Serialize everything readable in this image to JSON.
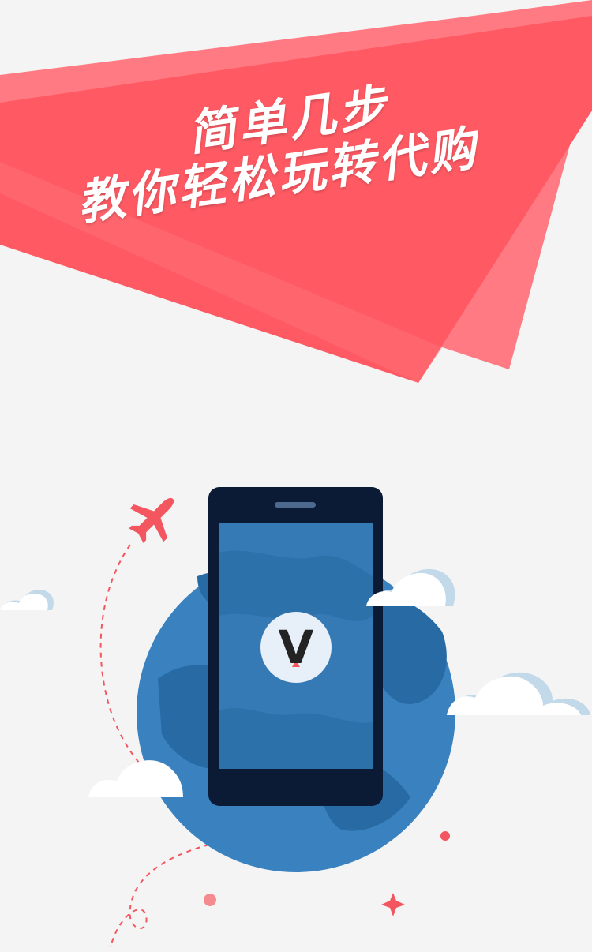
{
  "headline": {
    "line1": "简单几步",
    "line2": "教你轻松玩转代购"
  },
  "logo": {
    "letter": "V"
  },
  "colors": {
    "background": "#f4f4f4",
    "banner_primary": "#ff5a63",
    "banner_secondary": "#ff7a82",
    "globe": "#3a82bf",
    "globe_dark": "#276aa4",
    "phone": "#0b1b36",
    "accent_red": "#f45660",
    "cloud": "#ffffff",
    "cloud_shadow": "#c2d9ea"
  },
  "icons": [
    "airplane-icon",
    "cloud-icon",
    "globe-icon",
    "phone-icon",
    "sparkle-icon",
    "logo-v-icon"
  ]
}
